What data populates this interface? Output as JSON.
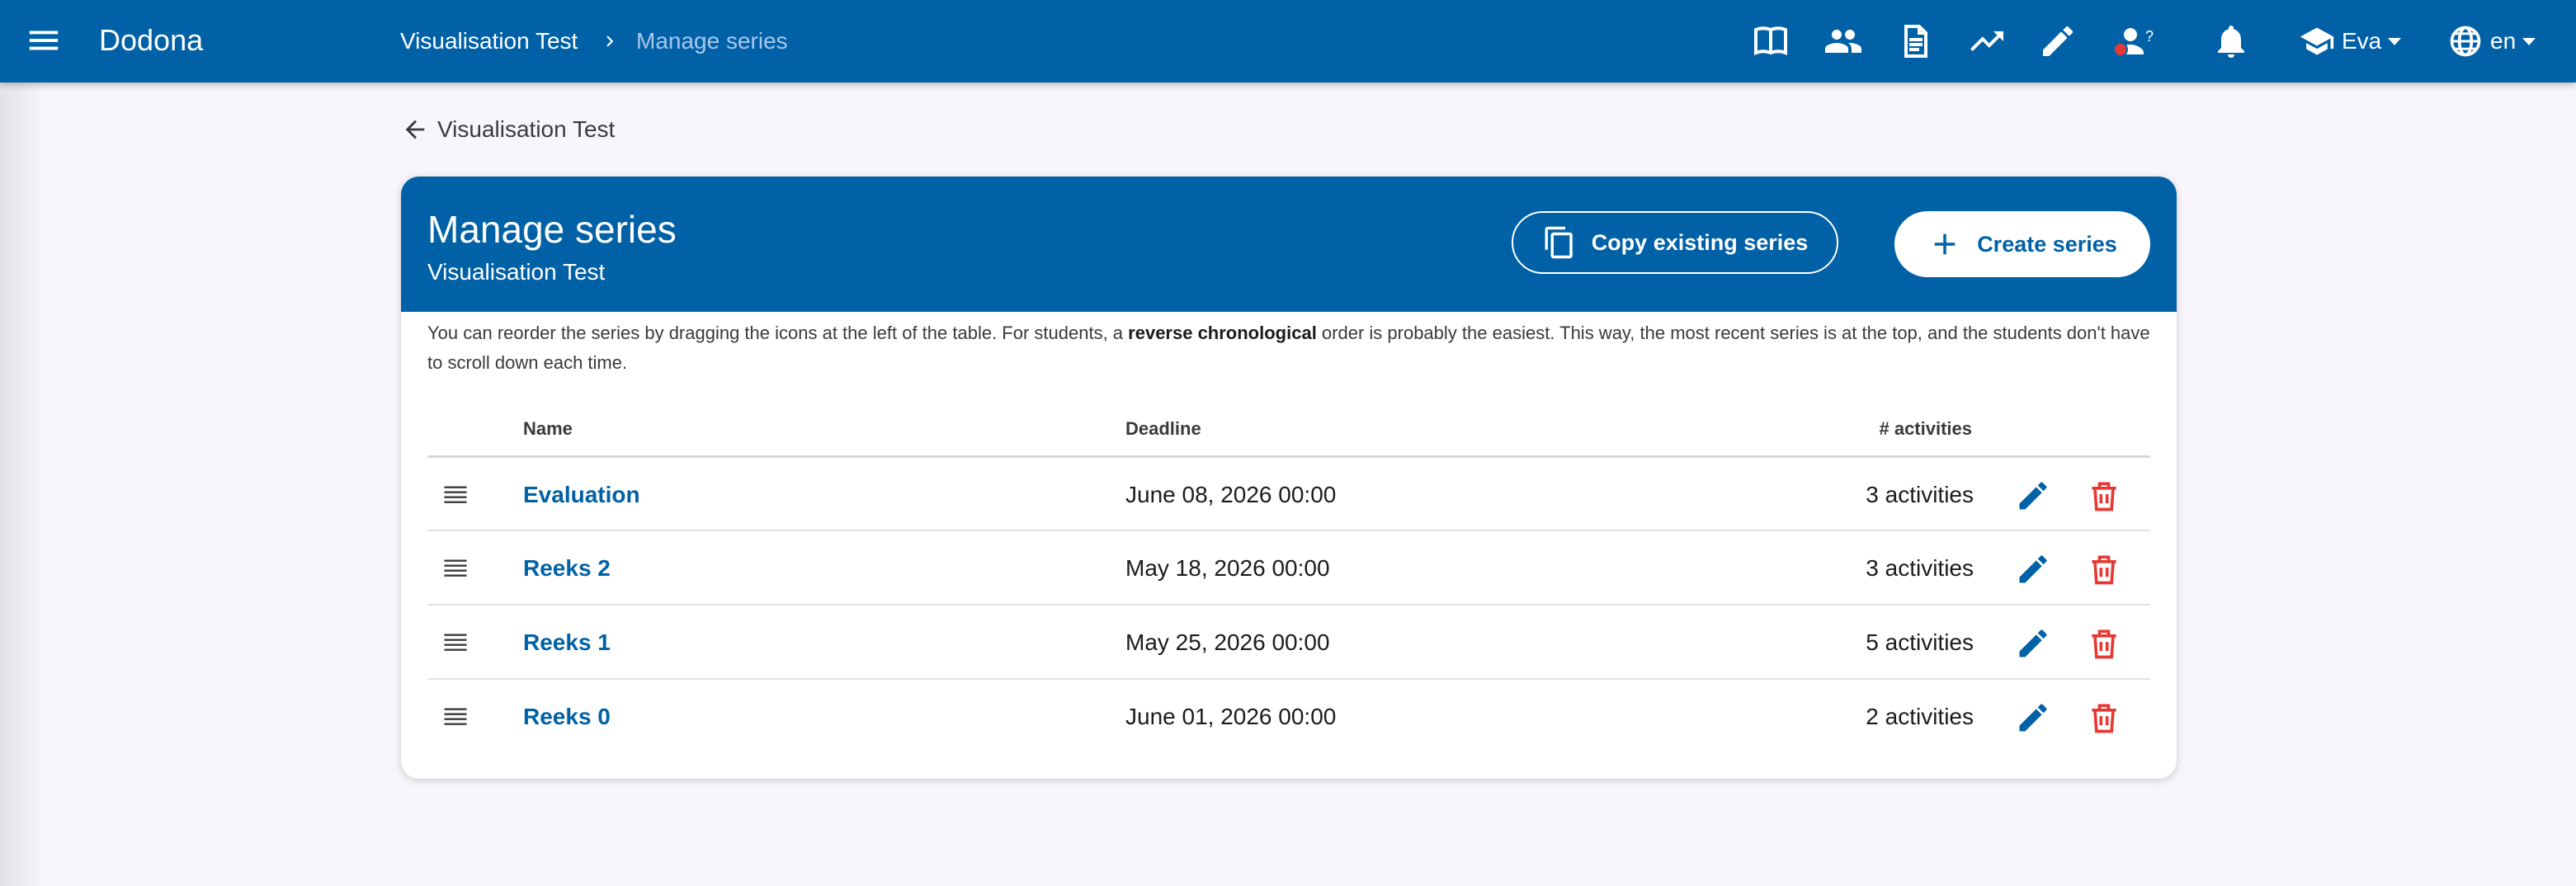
{
  "app": {
    "title": "Dodona"
  },
  "breadcrumb": {
    "course": "Visualisation Test",
    "current": "Manage series"
  },
  "nav": {
    "icons": [
      "library-icon",
      "people-icon",
      "document-icon",
      "trending-up-icon",
      "pencil-icon",
      "user-question-icon",
      "bell-icon"
    ],
    "user": {
      "name": "Eva",
      "icon": "school-icon"
    },
    "language": {
      "code": "en",
      "icon": "globe-icon"
    },
    "status_dot_color": "#e53935"
  },
  "back_link": {
    "label": "Visualisation Test"
  },
  "card": {
    "title": "Manage series",
    "subtitle": "Visualisation Test",
    "copy_button": "Copy existing series",
    "create_button": "Create series",
    "help": {
      "before": "You can reorder the series by dragging the icons at the left of the table. For students, a ",
      "bold": "reverse chronological",
      "after": " order is probably the easiest. This way, the most recent series is at the top, and the students don't have to scroll down each time."
    }
  },
  "table": {
    "headers": {
      "name": "Name",
      "deadline": "Deadline",
      "activities": "# activities"
    },
    "rows": [
      {
        "name": "Evaluation",
        "deadline": "June 08, 2026 00:00",
        "activities": "3 activities"
      },
      {
        "name": "Reeks 2",
        "deadline": "May 18, 2026 00:00",
        "activities": "3 activities"
      },
      {
        "name": "Reeks 1",
        "deadline": "May 25, 2026 00:00",
        "activities": "5 activities"
      },
      {
        "name": "Reeks 0",
        "deadline": "June 01, 2026 00:00",
        "activities": "2 activities"
      }
    ]
  },
  "colors": {
    "primary": "#0061a7",
    "danger": "#e53935",
    "background": "#f8f6fb"
  }
}
